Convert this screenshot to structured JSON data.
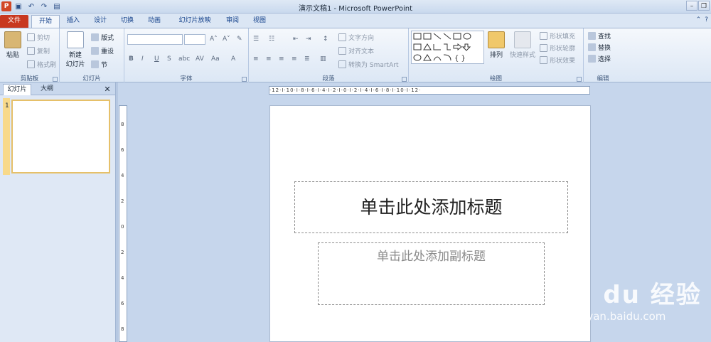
{
  "window": {
    "title": "演示文稿1 - Microsoft PowerPoint",
    "app_icon": "P"
  },
  "qat": [
    "save-icon",
    "undo-icon",
    "redo-icon",
    "open-icon"
  ],
  "tabs": [
    {
      "label": "文件"
    },
    {
      "label": "开始"
    },
    {
      "label": "插入"
    },
    {
      "label": "设计"
    },
    {
      "label": "切换"
    },
    {
      "label": "动画"
    },
    {
      "label": "幻灯片放映"
    },
    {
      "label": "审阅"
    },
    {
      "label": "视图"
    }
  ],
  "ribbon": {
    "clipboard": {
      "label": "剪贴板",
      "paste": "粘贴",
      "cut": "剪切",
      "copy": "复制",
      "format_painter": "格式刷"
    },
    "slides": {
      "label": "幻灯片",
      "new_slide_1": "新建",
      "new_slide_2": "幻灯片",
      "layout": "版式",
      "reset": "重设",
      "section": "节"
    },
    "font": {
      "label": "字体"
    },
    "paragraph": {
      "label": "段落",
      "text_direction": "文字方向",
      "align_text": "对齐文本",
      "convert_smartart": "转换为 SmartArt"
    },
    "drawing": {
      "label": "绘图",
      "arrange": "排列",
      "quick_styles": "快速样式",
      "shape_fill": "形状填充",
      "shape_outline": "形状轮廓",
      "shape_effects": "形状效果"
    },
    "editing": {
      "label": "编辑",
      "find": "查找",
      "replace": "替换",
      "select": "选择"
    }
  },
  "panel": {
    "tab_slides": "幻灯片",
    "tab_outline": "大纲",
    "slide_number": "1"
  },
  "ruler": {
    "h": "·12·I·10·I·8·I·6·I·4·I·2·I·0·I·2·I·4·I·6·I·8·I·10·I·12·",
    "v": [
      "8",
      "6",
      "4",
      "2",
      "0",
      "2",
      "4",
      "6",
      "8"
    ]
  },
  "slide": {
    "title_placeholder": "单击此处添加标题",
    "subtitle_placeholder": "单击此处添加副标题"
  },
  "watermark": {
    "brand": "Bai du 经验",
    "url": "jingyan.baidu.com"
  },
  "colors": {
    "file_tab": "#c8381f",
    "ribbon_bg": "#dce7f5",
    "workspace": "#c6d6ec"
  }
}
